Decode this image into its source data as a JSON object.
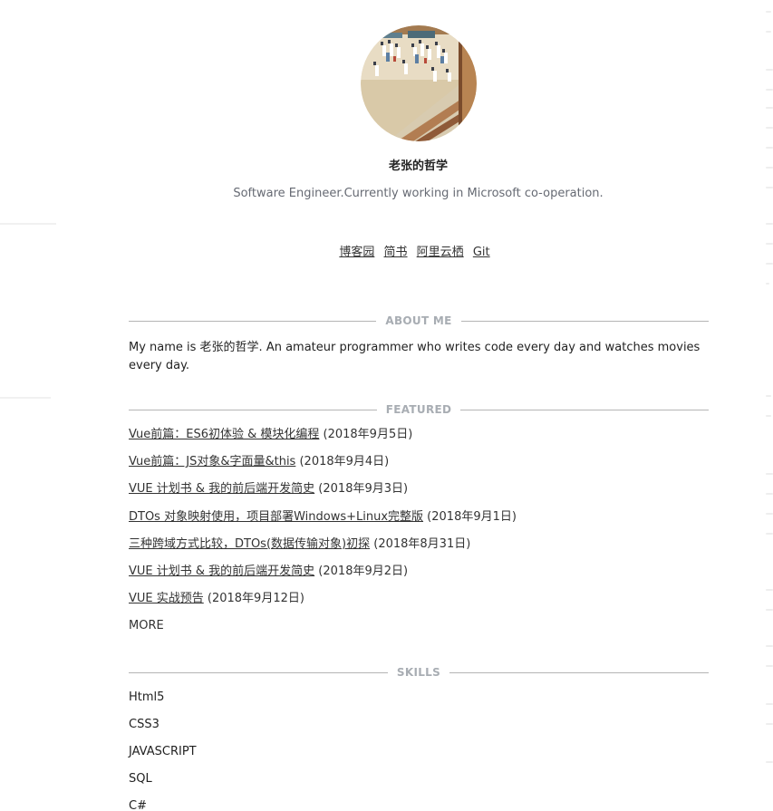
{
  "profile": {
    "name": "老张的哲学",
    "subtitle": "Software Engineer.Currently working in Microsoft co-operation."
  },
  "links": [
    {
      "label": "博客园"
    },
    {
      "label": "简书"
    },
    {
      "label": "阿里云栖"
    },
    {
      "label": "Git"
    }
  ],
  "about": {
    "heading": "ABOUT ME",
    "text": "My name is 老张的哲学. An amateur programmer who writes code every day and watches movies every day."
  },
  "featured": {
    "heading": "FEATURED",
    "items": [
      {
        "title": "Vue前篇：ES6初体验 & 模块化编程",
        "date": " (2018年9月5日)"
      },
      {
        "title": "Vue前篇：JS对象&字面量&this",
        "date": " (2018年9月4日)"
      },
      {
        "title": "VUE 计划书 & 我的前后端开发简史",
        "date": " (2018年9月3日)"
      },
      {
        "title": "DTOs 对象映射使用，项目部署Windows+Linux完整版",
        "date": " (2018年9月1日)"
      },
      {
        "title": "三种跨域方式比较，DTOs(数据传输对象)初探",
        "date": " (2018年8月31日)"
      },
      {
        "title": "VUE 计划书 & 我的前后端开发简史",
        "date": " (2018年9月2日)"
      },
      {
        "title": "VUE 实战预告",
        "date": " (2018年9月12日)"
      }
    ],
    "more": "MORE"
  },
  "skills": {
    "heading": "SKILLS",
    "items": [
      "Html5",
      "CSS3",
      "JAVASCRIPT",
      "SQL",
      "C#"
    ]
  },
  "colors": {
    "heading_text": "#a8adb3",
    "divider": "#b5b5b5",
    "subtitle": "#666a73"
  },
  "icons": {
    "avatar": "avatar-painting"
  }
}
